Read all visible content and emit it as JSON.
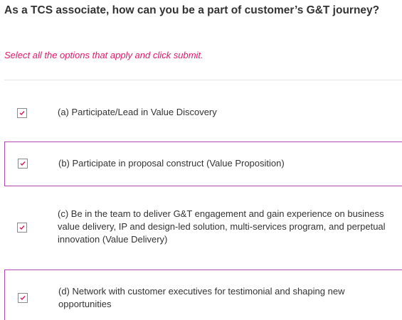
{
  "question": {
    "text": "As a TCS associate, how can you be a part of customer’s G&T journey?"
  },
  "instruction": {
    "text": "Select all the options that apply and click submit."
  },
  "options": [
    {
      "label": "(a) Participate/Lead in Value Discovery",
      "checked": true,
      "checkbox_icon": "checkmark-icon"
    },
    {
      "label": "(b) Participate in proposal construct (Value Proposition)",
      "checked": true,
      "checkbox_icon": "checkmark-icon"
    },
    {
      "label": "(c) Be in the team to deliver G&T engagement and gain experience on business value delivery, IP and design-led solution, multi-services program, and perpetual innovation (Value Delivery)",
      "checked": true,
      "checkbox_icon": "checkmark-icon"
    },
    {
      "label": "(d) Network with customer executives for testimonial and shaping new opportunities",
      "checked": true,
      "checkbox_icon": "checkmark-icon"
    }
  ],
  "colors": {
    "accent": "#e5176b",
    "frame": "#b04ab0",
    "checkmark": "#d9174f",
    "text": "#333333"
  }
}
